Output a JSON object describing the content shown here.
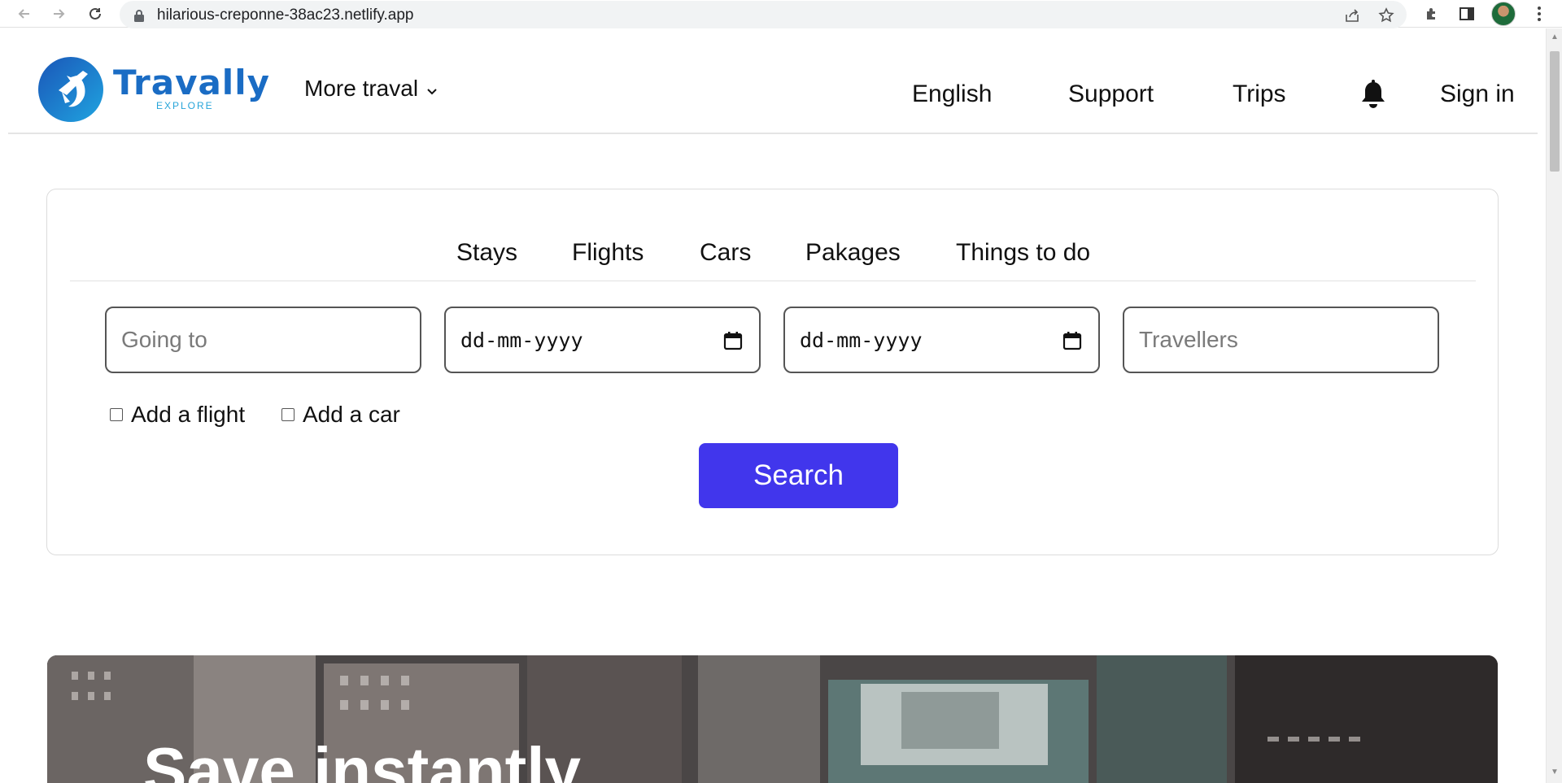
{
  "browser": {
    "url": "hilarious-creponne-38ac23.netlify.app",
    "icons": [
      "back-icon",
      "forward-icon",
      "reload-icon",
      "lock-icon",
      "share-icon",
      "star-icon",
      "extensions-icon",
      "side-panel-icon",
      "profile-avatar",
      "kebab-menu-icon"
    ]
  },
  "header": {
    "brand_name": "Travally",
    "brand_sub": "EXPLORE",
    "more_travel": "More traval",
    "nav": {
      "language": "English",
      "support": "Support",
      "trips": "Trips",
      "sign_in": "Sign in"
    }
  },
  "search": {
    "tabs": [
      "Stays",
      "Flights",
      "Cars",
      "Pakages",
      "Things to do"
    ],
    "going_to_placeholder": "Going to",
    "checkin_placeholder": "dd-mm-yyyy",
    "checkout_placeholder": "dd-mm-yyyy",
    "travellers_placeholder": "Travellers",
    "add_flight_label": "Add a flight",
    "add_car_label": "Add a car",
    "search_label": "Search"
  },
  "hero": {
    "title": "Save instantly"
  },
  "colors": {
    "brand": "#1a6cc4",
    "brand_sub": "#26a4d9",
    "search_button": "#4136ec"
  }
}
